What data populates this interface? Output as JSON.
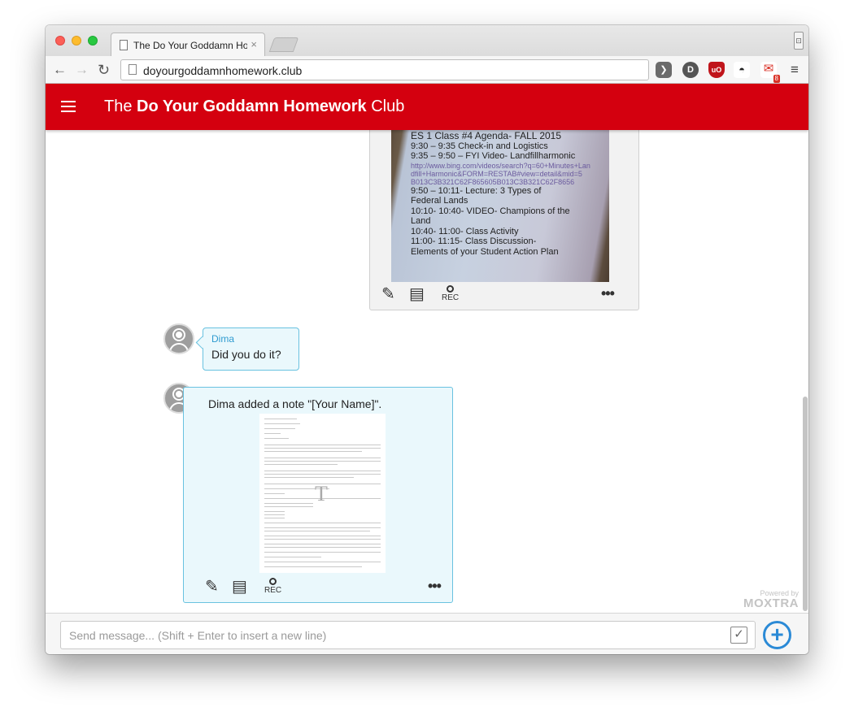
{
  "browser": {
    "tab_title": "The Do Your Goddamn Homework Club",
    "tab_close": "×",
    "url": "doyourgoddamnhomework.club",
    "gmail_badge": "8"
  },
  "app": {
    "title_prefix": "The ",
    "title_bold": "Do Your Goddamn Homework",
    "title_suffix": " Club",
    "brand_color": "#d4000f"
  },
  "messages": {
    "photo_card": {
      "photo_lines": [
        "ES 1 Class #4 Agenda- FALL 2015",
        "9:30 –   9:35 Check-in and Logistics",
        "9:35 –   9:50 – FYI Video- Landfillharmonic",
        "http://www.bing.com/videos/search?q=60+Minutes+Lan",
        "dfill+Harmonic&FORM=RESTAB#view=detail&mid=5",
        "B013C3B321C62F865605B013C3B321C62F8656",
        "9:50 –  10:11- Lecture: 3 Types of",
        "Federal Lands",
        "10:10- 10:40- VIDEO- Champions of the",
        "Land",
        "10:40- 11:00- Class Activity",
        "11:00- 11:15- Class Discussion-",
        "Elements of your Student Action Plan"
      ],
      "rec_label": "REC",
      "more_label": "•••"
    },
    "chat_bubble": {
      "author": "Dima",
      "text": "Did you do it?"
    },
    "note_card": {
      "text": "Dima added a note \"[Your Name]\".",
      "doc_glyph": "T",
      "rec_label": "REC",
      "more_label": "•••"
    }
  },
  "powered_by": {
    "label": "Powered by",
    "brand": "MOXTRA"
  },
  "composer": {
    "placeholder": "Send message... (Shift + Enter to insert a new line)",
    "value": ""
  },
  "icons": {
    "back": "back-arrow-icon",
    "forward": "forward-arrow-icon",
    "reload": "reload-icon",
    "edit": "pencil-icon",
    "comment": "comment-icon",
    "record": "record-icon",
    "more": "more-icon",
    "checklist": "checklist-icon",
    "add": "plus-circle-icon"
  }
}
